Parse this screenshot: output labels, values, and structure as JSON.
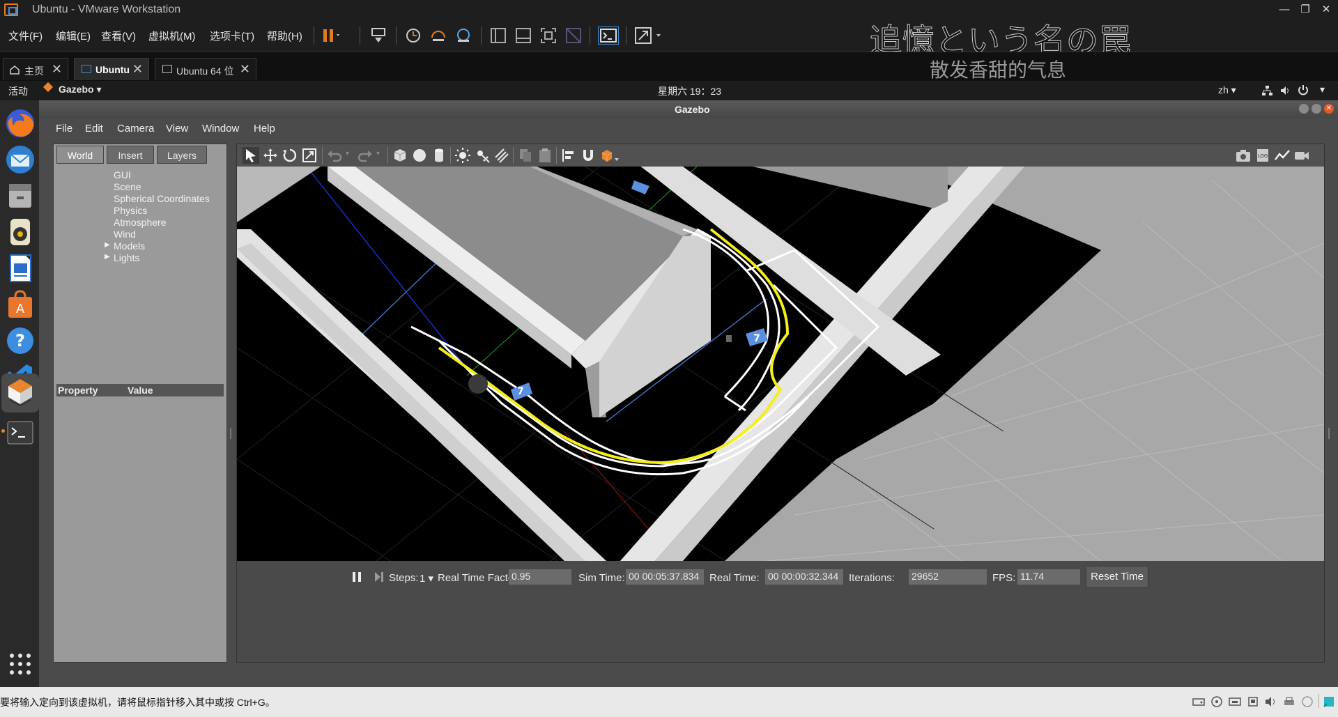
{
  "vmware": {
    "title": "Ubuntu - VMware Workstation",
    "menus": [
      "文件(F)",
      "编辑(E)",
      "查看(V)",
      "虚拟机(M)",
      "选项卡(T)",
      "帮助(H)"
    ],
    "overlay_title": "追憶という名の罠",
    "overlay_subtitle": "散发香甜的气息",
    "tabs": [
      {
        "label": "主页"
      },
      {
        "label": "Ubuntu"
      },
      {
        "label": "Ubuntu 64 位"
      }
    ],
    "status_text": "要将输入定向到该虚拟机，请将鼠标指针移入其中或按 Ctrl+G。"
  },
  "ubuntu_panel": {
    "activities": "活动",
    "app_name": "Gazebo",
    "clock": "星期六 19：23",
    "lang": "zh"
  },
  "gazebo": {
    "title": "Gazebo",
    "menus": [
      "File",
      "Edit",
      "Camera",
      "View",
      "Window",
      "Help"
    ],
    "left_tabs": [
      "World",
      "Insert",
      "Layers"
    ],
    "tree": [
      "GUI",
      "Scene",
      "Spherical Coordinates",
      "Physics",
      "Atmosphere",
      "Models",
      "Lights"
    ],
    "property_header": {
      "property": "Property",
      "value": "Value"
    },
    "bottom": {
      "steps_label": "Steps:",
      "steps_value": "1",
      "rtf_label": "Real Time Factor:",
      "rtf_value": "0.95",
      "sim_label": "Sim Time:",
      "sim_value": "00 00:05:37.834",
      "real_label": "Real Time:",
      "real_value": "00 00:00:32.344",
      "iter_label": "Iterations:",
      "iter_value": "29652",
      "fps_label": "FPS:",
      "fps_value": "11.74",
      "reset_label": "Reset Time"
    },
    "sign_label": "7"
  },
  "colors": {
    "vmware_orange": "#e07b1f",
    "lane_yellow": "#f4ee1a",
    "grid_blue": "#3f6fc2"
  }
}
